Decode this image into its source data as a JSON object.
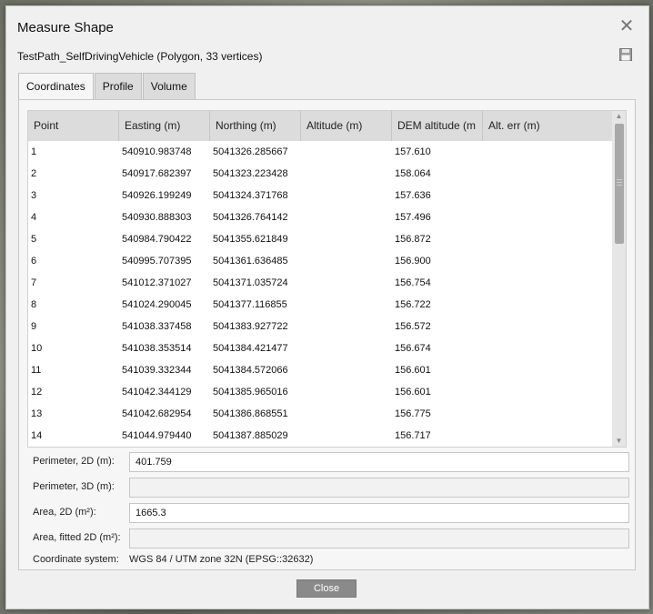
{
  "dialog": {
    "title": "Measure Shape",
    "subtitle": "TestPath_SelfDrivingVehicle (Polygon, 33 vertices)",
    "close_icon": "close-icon",
    "save_icon": "save-icon"
  },
  "tabs": [
    {
      "label": "Coordinates",
      "active": true
    },
    {
      "label": "Profile",
      "active": false
    },
    {
      "label": "Volume",
      "active": false
    }
  ],
  "table": {
    "columns": [
      "Point",
      "Easting (m)",
      "Northing (m)",
      "Altitude (m)",
      "DEM altitude (m",
      "Alt. err (m)"
    ],
    "rows": [
      [
        "1",
        "540910.983748",
        "5041326.285667",
        "",
        "157.610",
        ""
      ],
      [
        "2",
        "540917.682397",
        "5041323.223428",
        "",
        "158.064",
        ""
      ],
      [
        "3",
        "540926.199249",
        "5041324.371768",
        "",
        "157.636",
        ""
      ],
      [
        "4",
        "540930.888303",
        "5041326.764142",
        "",
        "157.496",
        ""
      ],
      [
        "5",
        "540984.790422",
        "5041355.621849",
        "",
        "156.872",
        ""
      ],
      [
        "6",
        "540995.707395",
        "5041361.636485",
        "",
        "156.900",
        ""
      ],
      [
        "7",
        "541012.371027",
        "5041371.035724",
        "",
        "156.754",
        ""
      ],
      [
        "8",
        "541024.290045",
        "5041377.116855",
        "",
        "156.722",
        ""
      ],
      [
        "9",
        "541038.337458",
        "5041383.927722",
        "",
        "156.572",
        ""
      ],
      [
        "10",
        "541038.353514",
        "5041384.421477",
        "",
        "156.674",
        ""
      ],
      [
        "11",
        "541039.332344",
        "5041384.572066",
        "",
        "156.601",
        ""
      ],
      [
        "12",
        "541042.344129",
        "5041385.965016",
        "",
        "156.601",
        ""
      ],
      [
        "13",
        "541042.682954",
        "5041386.868551",
        "",
        "156.775",
        ""
      ],
      [
        "14",
        "541044.979440",
        "5041387.885029",
        "",
        "156.717",
        ""
      ]
    ]
  },
  "fields": {
    "perimeter_2d": {
      "label": "Perimeter, 2D (m):",
      "value": "401.759"
    },
    "perimeter_3d": {
      "label": "Perimeter, 3D (m):",
      "value": ""
    },
    "area_2d": {
      "label": "Area, 2D (m²):",
      "value": "1665.3"
    },
    "area_fitted_2d": {
      "label": "Area, fitted 2D (m²):",
      "value": ""
    },
    "coordinate_system": {
      "label": "Coordinate system:",
      "value": "WGS 84 / UTM zone 32N (EPSG::32632)"
    }
  },
  "buttons": {
    "close": "Close"
  }
}
